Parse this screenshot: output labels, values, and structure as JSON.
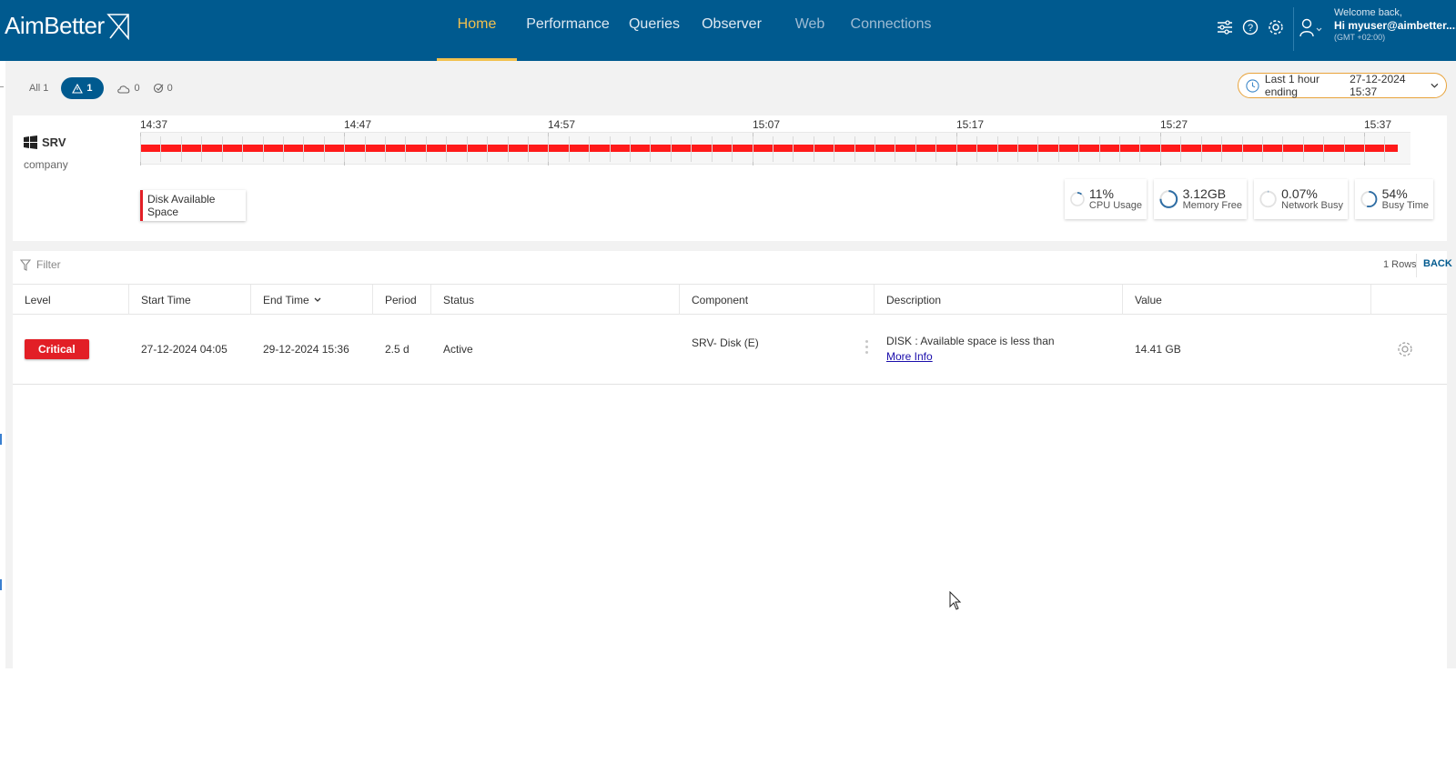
{
  "header": {
    "logo_text": "AimBetter",
    "nav": [
      {
        "label": "Home",
        "active": true
      },
      {
        "label": "Performance"
      },
      {
        "label": "Queries"
      },
      {
        "label": "Observer"
      },
      {
        "label": "Web"
      },
      {
        "label": "Connections"
      }
    ],
    "welcome": "Welcome back,",
    "user": "Hi myuser@aimbetter....",
    "timezone": "(GMT +02:00)",
    "colors": {
      "bar": "#005a8f",
      "active": "#f2c14e"
    }
  },
  "filters": {
    "all": "All 1",
    "alerts": "1",
    "cloud": "0",
    "check": "0"
  },
  "time_range": {
    "label": "Last 1 hour ending",
    "value": "27-12-2024 15:37"
  },
  "server": {
    "name": "SRV",
    "company": "company",
    "ticks": [
      "14:37",
      "14:47",
      "14:57",
      "15:07",
      "15:17",
      "15:27",
      "15:37"
    ],
    "alert_chip": "Disk Available Space",
    "metrics": [
      {
        "value": "11%",
        "label": "CPU Usage",
        "fraction": 0.11
      },
      {
        "value": "3.12GB",
        "label": "Memory Free",
        "fraction": 0.75
      },
      {
        "value": "0.07%",
        "label": "Network Busy",
        "fraction": 0.01
      },
      {
        "value": "54%",
        "label": "Busy Time",
        "fraction": 0.54
      }
    ]
  },
  "table": {
    "filter_placeholder": "Filter",
    "rows_count": "1 Rows",
    "back": "BACK",
    "columns": [
      "Level",
      "Start Time",
      "End Time",
      "Period",
      "Status",
      "Component",
      "Description",
      "Value"
    ],
    "rows": [
      {
        "level": "Critical",
        "start": "27-12-2024 04:05",
        "end": "29-12-2024 15:36",
        "period": "2.5 d",
        "status": "Active",
        "component": "SRV- Disk (E)",
        "description": "DISK : Available space is less than",
        "more_info": "More Info",
        "value": "14.41 GB"
      }
    ]
  }
}
